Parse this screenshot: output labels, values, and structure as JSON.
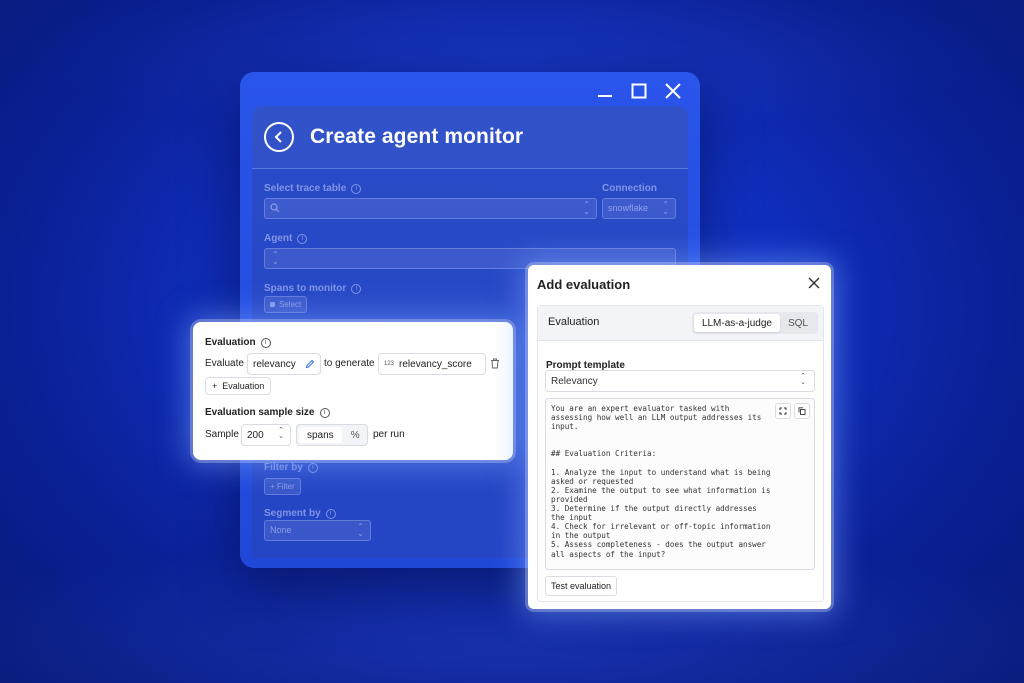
{
  "window": {
    "title": "Create agent monitor",
    "trace_table_label": "Select trace table",
    "connection_label": "Connection",
    "connection_value": "snowflake",
    "agent_label": "Agent",
    "spans_label": "Spans to monitor",
    "spans_chip": "Select",
    "filter_label": "Filter by",
    "filter_chip": "+ Filter",
    "segment_label": "Segment by",
    "segment_value": "None"
  },
  "evaluation_card": {
    "heading": "Evaluation",
    "evaluate_label": "Evaluate",
    "metric": "relevancy",
    "to_generate_label": "to generate",
    "output_type_glyph": "123",
    "output_field": "relevancy_score",
    "add_button": "Evaluation",
    "sample_heading": "Evaluation sample size",
    "sample_label": "Sample",
    "sample_value": "200",
    "unit_spans": "spans",
    "unit_percent": "%",
    "per_run": "per run"
  },
  "add_evaluation": {
    "title": "Add evaluation",
    "section_label": "Evaluation",
    "tabs": [
      "LLM-as-a-judge",
      "SQL"
    ],
    "active_tab": "LLM-as-a-judge",
    "prompt_template_label": "Prompt template",
    "template_value": "Relevancy",
    "prompt_text": "You are an expert evaluator tasked with\nassessing how well an LLM output addresses its\ninput.\n\n\n## Evaluation Criteria:\n\n1. Analyze the input to understand what is being\nasked or requested\n2. Examine the output to see what information is\nprovided\n3. Determine if the output directly addresses\nthe input\n4. Check for irrelevant or off-topic information\nin the output\n5. Assess completeness - does the output answer\nall aspects of the input?",
    "test_button": "Test evaluation"
  },
  "colors": {
    "background": "#1030c2",
    "window": "#2048d8",
    "card": "#ffffff"
  },
  "icons": [
    "minimize-icon",
    "maximize-icon",
    "close-icon",
    "back-arrow-icon",
    "search-icon",
    "edit-icon",
    "trash-icon",
    "expand-icon",
    "copy-icon",
    "info-icon"
  ]
}
